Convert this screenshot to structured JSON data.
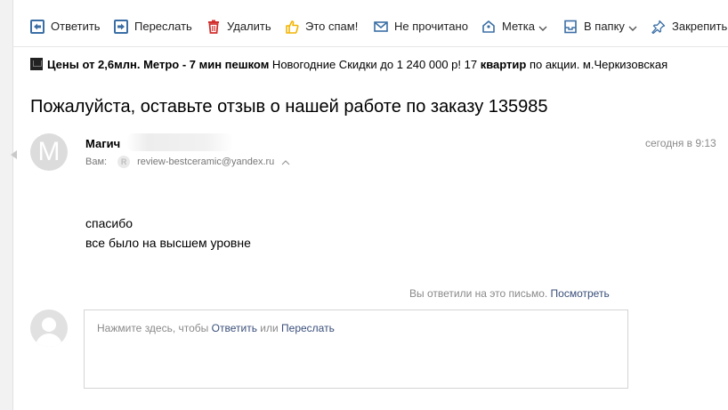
{
  "toolbar": {
    "reply": {
      "label": "Ответить",
      "icon": "reply-icon"
    },
    "forward": {
      "label": "Переслать",
      "icon": "forward-icon"
    },
    "delete": {
      "label": "Удалить",
      "icon": "trash-icon"
    },
    "spam": {
      "label": "Это спам!",
      "icon": "thumb-down-icon"
    },
    "unread": {
      "label": "Не прочитано",
      "icon": "envelope-icon"
    },
    "label": {
      "label": "Метка",
      "icon": "tag-icon"
    },
    "folder": {
      "label": "В папку",
      "icon": "folder-icon"
    },
    "pin": {
      "label": "Закрепить",
      "icon": "pin-icon"
    }
  },
  "ad": {
    "bold_text": "Цены от 2,6млн. Метро - 7 мин пешком",
    "text1": " Новогодние Скидки до 1 240 000 р! 17 ",
    "bold_text2": "квартир",
    "text2": " по акции. м.Черкизовская"
  },
  "message": {
    "subject": "Пожалуйста, оставьте отзыв о нашей работе по заказу 135985",
    "sender_initial": "M",
    "sender_name": "Магич",
    "to_label": "Вам:",
    "to_badge": "R",
    "to_email": "review-bestceramic@yandex.ru",
    "time": "сегодня в 9:13",
    "body_line1": "спасибо",
    "body_line2": "все было на высшем уровне",
    "replied_text": "Вы ответили на это письмо.",
    "replied_link": "Посмотреть"
  },
  "reply": {
    "prompt_prefix": "Нажмите здесь, чтобы ",
    "reply_link": "Ответить",
    "or_text": " или ",
    "forward_link": "Переслать"
  },
  "colors": {
    "accent_blue": "#3a6ea5",
    "delete_red": "#d22e2e",
    "spam_yellow": "#f2b400",
    "link": "#3a4f7a"
  }
}
